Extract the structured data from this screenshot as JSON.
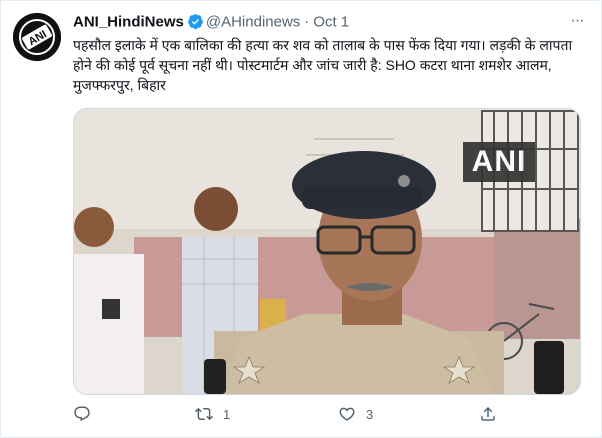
{
  "tweet": {
    "author_name": "ANI_HindiNews",
    "handle": "@AHindinews",
    "separator": "·",
    "date": "Oct 1",
    "more": "···",
    "avatar_logo_text": "ANI",
    "text": "पहसौल इलाके में एक बालिका की हत्या कर शव को तालाब के पास फेंक दिया गया। लड़की के लापता होने की कोई पूर्व सूचना नहीं थी। पोस्टमार्टम और जांच जारी है: SHO कटरा थाना शमशेर आलम, मुजफ्फरपुर, बिहार",
    "media": {
      "watermark": "ANI"
    },
    "actions": {
      "reply_count": "",
      "retweet_count": "1",
      "like_count": "3"
    }
  },
  "colors": {
    "verified": "#1d9bf0",
    "muted": "#536471",
    "text": "#0f1419"
  },
  "icons": [
    "verified-badge-icon",
    "more-icon",
    "reply-icon",
    "retweet-icon",
    "like-icon",
    "share-icon"
  ]
}
